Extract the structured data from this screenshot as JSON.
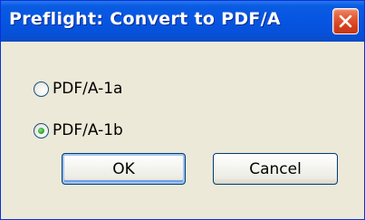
{
  "window": {
    "title": "Preflight: Convert to PDF/A",
    "close_icon": "close-x-icon"
  },
  "options": [
    {
      "label": "PDF/A-1a",
      "selected": false
    },
    {
      "label": "PDF/A-1b",
      "selected": true
    }
  ],
  "buttons": {
    "ok_label": "OK",
    "cancel_label": "Cancel"
  },
  "colors": {
    "titlebar": "#0755e3",
    "close_button": "#d4401b",
    "dialog_background": "#ece9d8",
    "radio_selected_dot": "#3fb43f"
  }
}
